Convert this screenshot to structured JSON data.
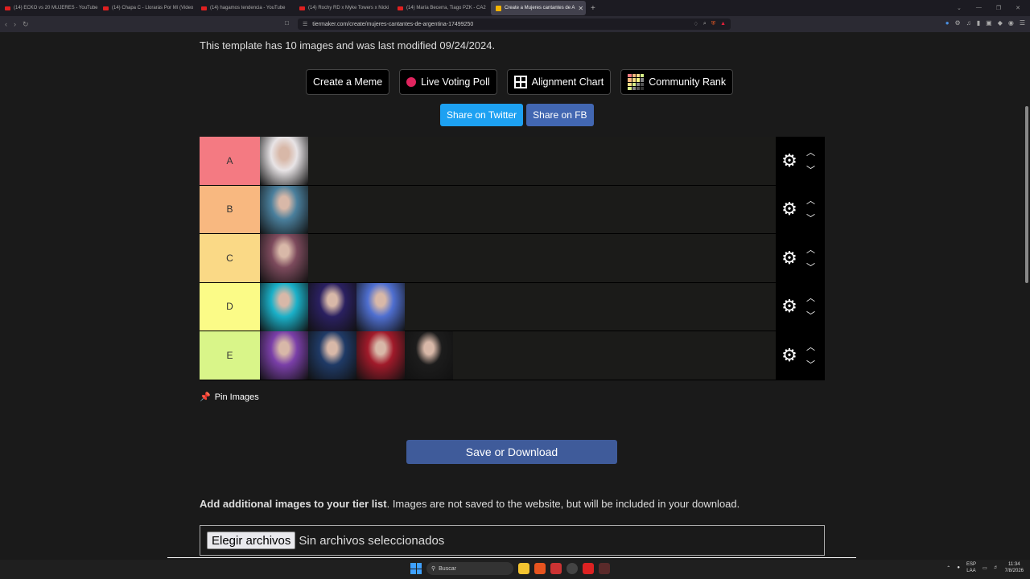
{
  "browser": {
    "tabs": [
      {
        "title": "(14) ECKO vs 20 MUJERES - YouTube",
        "favicon": "youtube-icon",
        "active": false
      },
      {
        "title": "(14) Chapa C - Llorarás Por Mí (Video",
        "favicon": "youtube-icon",
        "active": false
      },
      {
        "title": "(14) hagamos tendencia - YouTube",
        "favicon": "youtube-icon",
        "active": false
      },
      {
        "title": "(14) Rochy RD x Myke Towers x Nicki",
        "favicon": "youtube-icon",
        "active": false
      },
      {
        "title": "(14) María Becerra, Tiago PZK - CA2",
        "favicon": "youtube-icon",
        "active": false
      },
      {
        "title": "Create a Mujeres cantantes de A",
        "favicon": "tiermaker-icon",
        "active": true
      }
    ],
    "url": "tiermaker.com/create/mujeres-cantantes-de-argentina-17499250"
  },
  "page": {
    "info_text": "This template has 10 images and was last modified 09/24/2024.",
    "buttons": {
      "create_meme": "Create a Meme",
      "live_voting": "Live Voting Poll",
      "alignment": "Alignment Chart",
      "community": "Community Rank"
    },
    "share": {
      "twitter": "Share on Twitter",
      "fb": "Share on FB"
    },
    "tiers": [
      {
        "label": "A",
        "color": "#f47a82",
        "items": [
          {
            "bg": "#e8e4e6"
          }
        ]
      },
      {
        "label": "B",
        "color": "#f8b880",
        "items": [
          {
            "bg": "#4a7f9c"
          }
        ]
      },
      {
        "label": "C",
        "color": "#fad986",
        "items": [
          {
            "bg": "#7c4a5c"
          }
        ]
      },
      {
        "label": "D",
        "color": "#fbfb87",
        "items": [
          {
            "bg": "#1ab0c8"
          },
          {
            "bg": "#2a2060"
          },
          {
            "bg": "#4f6fd0"
          }
        ]
      },
      {
        "label": "E",
        "color": "#d9f589",
        "items": [
          {
            "bg": "#7a3fa8"
          },
          {
            "bg": "#1f3a66"
          },
          {
            "bg": "#a01a2a"
          },
          {
            "bg": "#1c1c1c"
          }
        ]
      }
    ],
    "pin_label": "Pin Images",
    "save_label": "Save or Download",
    "add_bold": "Add additional images to your tier list",
    "add_rest": ". Images are not saved to the website, but will be included in your download.",
    "file_button": "Elegir archivos",
    "file_status": "Sin archivos seleccionados"
  },
  "taskbar": {
    "search_placeholder": "Buscar",
    "lang": "ESP",
    "lang2": "LAA",
    "time": "11:34",
    "date": "7/8/2026"
  }
}
